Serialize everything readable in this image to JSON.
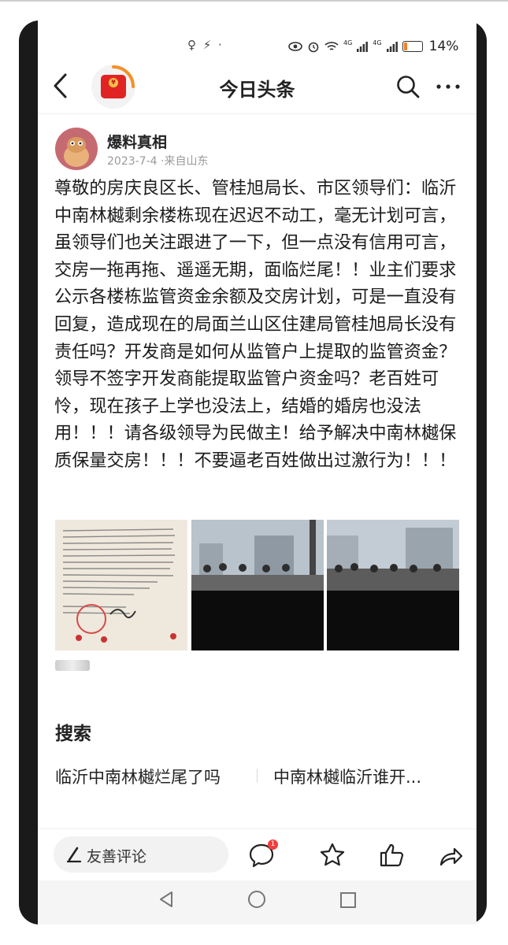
{
  "status_bar": {
    "left_icons": "♀ ⚡ ·",
    "battery_percent": "14%",
    "signal_label_1": "4G",
    "signal_label_2": "4G"
  },
  "header": {
    "title": "今日头条",
    "back_icon": "chevron-left-icon",
    "search_icon": "search-icon",
    "more_icon": "more-icon"
  },
  "post": {
    "author": "爆料真相",
    "meta": "2023-7-4 ·来自山东",
    "text": "尊敬的房庆良区长、管桂旭局长、市区领导们：临沂中南林樾剩余楼栋现在迟迟不动工，毫无计划可言，虽领导们也关注跟进了一下，但一点没有信用可言，交房一拖再拖、遥遥无期，面临烂尾！！业主们要求公示各楼栋监管资金余额及交房计划，可是一直没有回复，造成现在的局面兰山区住建局管桂旭局长没有责任吗？开发商是如何从监管户上提取的监管资金？领导不签字开发商能提取监管户资金吗？老百姓可怜，现在孩子上学也没法上，结婚的婚房也没法用！！！请各级领导为民做主！给予解决中南林樾保质保量交房！！！不要逼老百姓做出过激行为！！！",
    "images": [
      "document-photo",
      "crowd-photo",
      "crowd-photo"
    ]
  },
  "search": {
    "heading": "搜索",
    "suggestions": [
      "临沂中南林樾烂尾了吗",
      "中南林樾临沂谁开..."
    ]
  },
  "bottom_bar": {
    "comment_placeholder": "友善评论",
    "comment_badge": "1"
  },
  "colors": {
    "brand_red": "#e02424",
    "badge_red": "#f23d3d",
    "ring_orange": "#f5902a",
    "battery_orange": "#f0802a"
  }
}
